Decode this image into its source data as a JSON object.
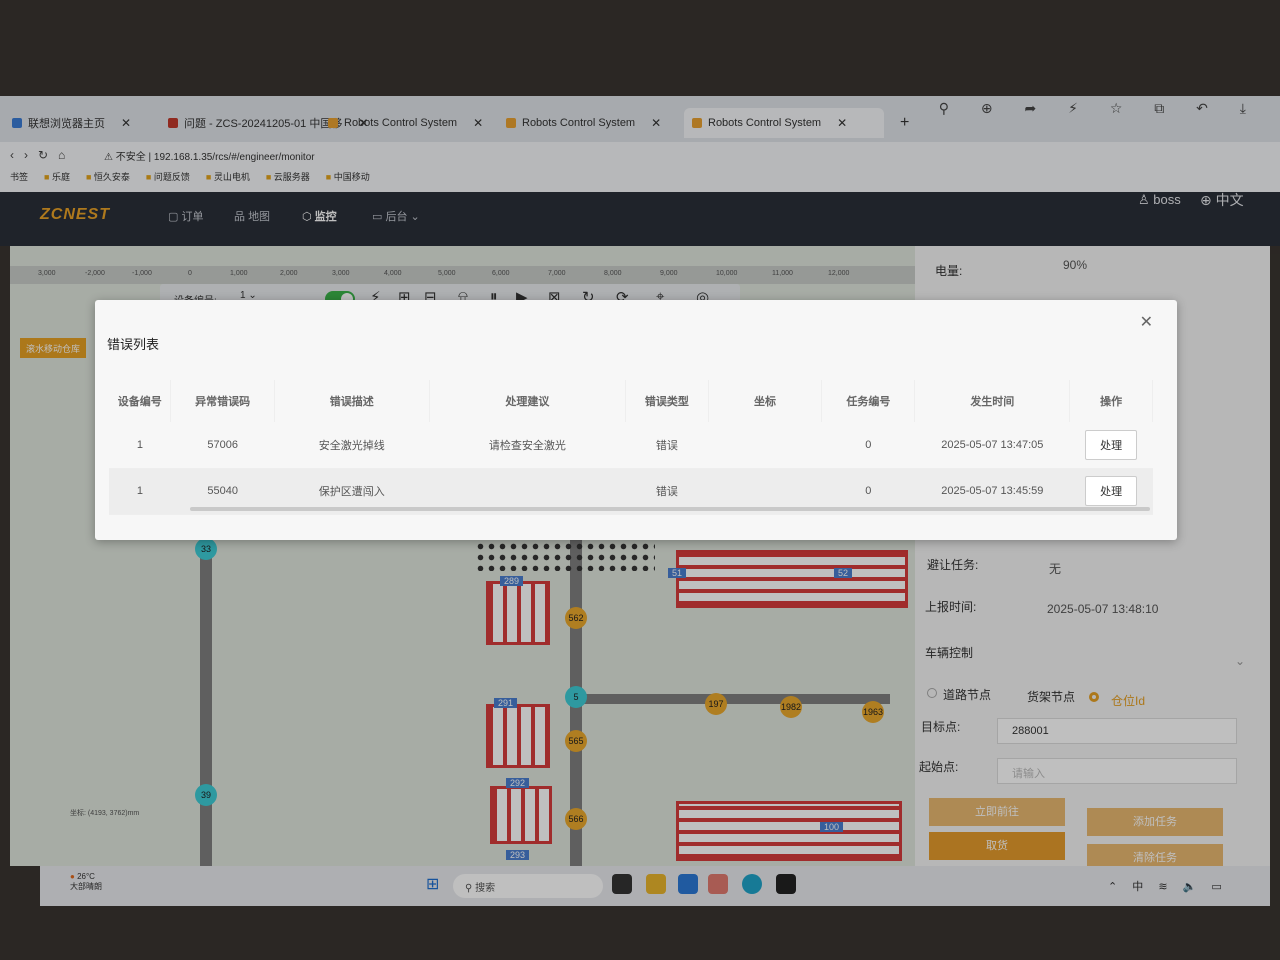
{
  "browser": {
    "tabs": [
      {
        "label": "联想浏览器主页"
      },
      {
        "label": "问题 - ZCS-20241205-01 中国移"
      },
      {
        "label": "Robots Control System"
      },
      {
        "label": "Robots Control System"
      },
      {
        "label": "Robots Control System"
      }
    ],
    "security_label": "不安全",
    "url": "192.168.1.35/rcs/#/engineer/monitor",
    "bookmarks": [
      "书签",
      "乐庭",
      "恒久安泰",
      "问题反馈",
      "灵山电机",
      "云服务器",
      "中国移动"
    ]
  },
  "header": {
    "logo": "ZCNEST",
    "nav": [
      "订单",
      "地图",
      "监控",
      "后台"
    ],
    "user": "boss",
    "language": "中文"
  },
  "map": {
    "ruler_ticks": [
      "3,000",
      "-2,000",
      "-1,000",
      "0",
      "1,000",
      "2,000",
      "3,000",
      "4,000",
      "5,000",
      "6,000",
      "7,000",
      "8,000",
      "9,000",
      "10,000",
      "11,000",
      "12,000"
    ],
    "toolbar": {
      "device_label": "设备编号:",
      "device_value": "1"
    },
    "side_label": "滚水移动仓库",
    "rack_labels": [
      "289",
      "291",
      "292",
      "293",
      "51",
      "52",
      "100"
    ],
    "nodes": [
      "562",
      "5",
      "565",
      "566",
      "197",
      "1982",
      "1963",
      "33",
      "39"
    ],
    "coord_readout": "坐标: (4193, 3762)mm"
  },
  "panel": {
    "battery_label": "电量:",
    "battery_value": "90%",
    "avoid_label": "避让任务:",
    "avoid_value": "无",
    "report_label": "上报时间:",
    "report_value": "2025-05-07 13:48:10",
    "control_label": "车辆控制",
    "radio_road": "道路节点",
    "radio_shelf": "货架节点",
    "radio_location": "仓位Id",
    "target_label": "目标点:",
    "target_value": "288001",
    "start_label": "起始点:",
    "start_placeholder": "请输入",
    "btn_go": "立即前往",
    "btn_add_task": "添加任务",
    "btn_pick": "取货",
    "btn_clear": "清除任务"
  },
  "modal": {
    "title": "错误列表",
    "columns": [
      "设备编号",
      "异常错误码",
      "错误描述",
      "处理建议",
      "错误类型",
      "坐标",
      "任务编号",
      "发生时间",
      "操作"
    ],
    "rows": [
      [
        "1",
        "57006",
        "安全激光掉线",
        "请检查安全激光",
        "错误",
        "",
        "0",
        "2025-05-07 13:47:05",
        "处理"
      ],
      [
        "1",
        "55040",
        "保护区遭闯入",
        "",
        "错误",
        "",
        "0",
        "2025-05-07 13:45:59",
        "处理"
      ]
    ]
  },
  "taskbar": {
    "weather_temp": "26°C",
    "weather_desc": "大部晴朗",
    "search_placeholder": "搜索",
    "ime": "中"
  }
}
